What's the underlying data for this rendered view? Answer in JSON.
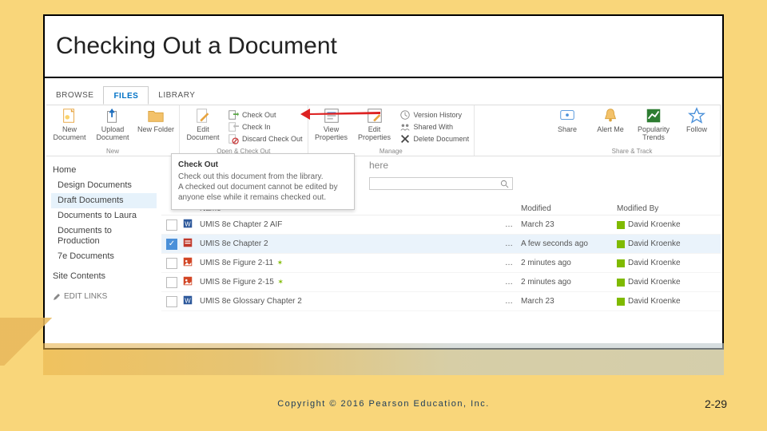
{
  "slide": {
    "title": "Checking Out a Document",
    "copyright": "Copyright © 2016 Pearson Education, Inc.",
    "page_number": "2-29"
  },
  "tabs": {
    "browse": "BROWSE",
    "files": "FILES",
    "library": "LIBRARY"
  },
  "ribbon": {
    "groups": {
      "new_group": {
        "label": "New",
        "new_document": "New Document",
        "upload_document": "Upload Document",
        "new_folder": "New Folder"
      },
      "open_group": {
        "label": "Open & Check Out",
        "edit_document": "Edit Document",
        "check_out": "Check Out",
        "check_in": "Check In",
        "discard": "Discard Check Out"
      },
      "manage_group": {
        "label": "Manage",
        "view_properties": "View Properties",
        "edit_properties": "Edit Properties",
        "version_history": "Version History",
        "shared_with": "Shared With",
        "delete_document": "Delete Document"
      },
      "share_group": {
        "label": "Share & Track",
        "share": "Share",
        "alert_me": "Alert Me",
        "popularity": "Popularity Trends",
        "follow": "Follow"
      }
    }
  },
  "tooltip": {
    "title": "Check Out",
    "body1": "Check out this document from the library.",
    "body2": "A checked out document cannot be edited by anyone else while it remains checked out."
  },
  "nav": {
    "home": "Home",
    "design": "Design Documents",
    "draft": "Draft Documents",
    "laura": "Documents to Laura",
    "production": "Documents to Production",
    "sevene": "7e Documents",
    "site_contents": "Site Contents",
    "edit_links": "EDIT LINKS"
  },
  "content": {
    "bg_text": "here",
    "headers": {
      "name": "Name",
      "modified": "Modified",
      "modified_by": "Modified By"
    },
    "rows": [
      {
        "icon": "word",
        "name": "UMIS 8e Chapter 2 AIF",
        "new": false,
        "dots": "…",
        "modified": "March 23",
        "modified_by": "David Kroenke",
        "selected": false
      },
      {
        "icon": "pdf",
        "name": "UMIS 8e Chapter 2",
        "new": false,
        "dots": "…",
        "modified": "A few seconds ago",
        "modified_by": "David Kroenke",
        "selected": true
      },
      {
        "icon": "img",
        "name": "UMIS 8e Figure 2-11",
        "new": true,
        "dots": "…",
        "modified": "2 minutes ago",
        "modified_by": "David Kroenke",
        "selected": false
      },
      {
        "icon": "img",
        "name": "UMIS 8e Figure 2-15",
        "new": true,
        "dots": "…",
        "modified": "2 minutes ago",
        "modified_by": "David Kroenke",
        "selected": false
      },
      {
        "icon": "word",
        "name": "UMIS 8e Glossary Chapter 2",
        "new": false,
        "dots": "…",
        "modified": "March 23",
        "modified_by": "David Kroenke",
        "selected": false
      }
    ]
  }
}
